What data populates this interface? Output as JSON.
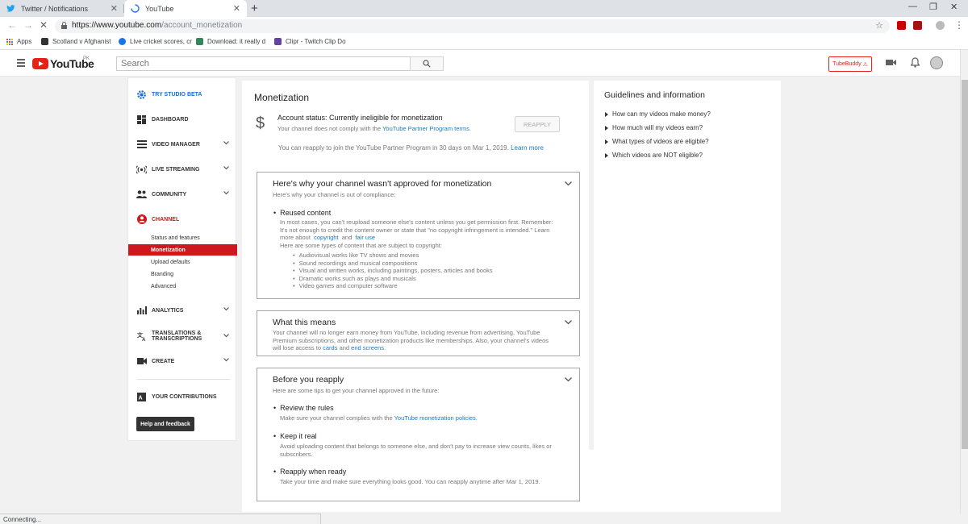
{
  "browser": {
    "tabs": [
      {
        "title": "Twitter / Notifications"
      },
      {
        "title": "YouTube"
      }
    ],
    "url_host": "https://www.youtube.com",
    "url_path": "/account_monetization",
    "bookmarks": [
      {
        "label": "Apps"
      },
      {
        "label": "Scotland v Afghanist"
      },
      {
        "label": "Live cricket scores, cr"
      },
      {
        "label": "Download: it really d"
      },
      {
        "label": "Clipr - Twitch Clip Do"
      }
    ],
    "status_text": "Connecting..."
  },
  "masthead": {
    "logo_text": "YouTube",
    "country": "PK",
    "search_placeholder": "Search",
    "tubebuddy_label": "TubeBuddy"
  },
  "leftnav": {
    "studio_beta": "TRY STUDIO BETA",
    "items": [
      {
        "label": "DASHBOARD"
      },
      {
        "label": "VIDEO MANAGER"
      },
      {
        "label": "LIVE STREAMING"
      },
      {
        "label": "COMMUNITY"
      },
      {
        "label": "CHANNEL"
      },
      {
        "label": "ANALYTICS"
      },
      {
        "label": "TRANSLATIONS & TRANSCRIPTIONS"
      },
      {
        "label": "CREATE"
      },
      {
        "label": "YOUR CONTRIBUTIONS"
      }
    ],
    "channel_subitems": [
      {
        "label": "Status and features"
      },
      {
        "label": "Monetization"
      },
      {
        "label": "Upload defaults"
      },
      {
        "label": "Branding"
      },
      {
        "label": "Advanced"
      }
    ],
    "help_button": "Help and feedback"
  },
  "main": {
    "title": "Monetization",
    "account_status": "Account status: Currently ineligible for monetization",
    "account_sub_prefix": "Your channel does not comply with the ",
    "account_sub_link": "YouTube Partner Program terms",
    "account_sub_suffix": ".",
    "reapply_button": "REAPPLY",
    "reapply_note": "You can reapply to join the YouTube Partner Program in 30 days on Mar 1, 2019.",
    "learn_more": "Learn more",
    "why": {
      "heading": "Here's why your channel wasn't approved for monetization",
      "sub": "Here's why your channel is out of compliance:",
      "bullet": "Reused content",
      "para_line1": "In most cases, you can't reupload someone else's content unless you get permission first. Remember:",
      "para_line2": "It's not enough to credit the content owner or state that \"no copyright infringement is intended.\" Learn",
      "para_line3_prefix": "more about",
      "copyright_link": "copyright",
      "and_word": "and",
      "fair_use_link": "fair use",
      "types_intro": "Here are some types of content that are subject to copyright:",
      "types": [
        "Audiovisual works like TV shows and movies",
        "Sound recordings and musical compositions",
        "Visual and written works, including paintings, posters, articles and books",
        "Dramatic works such as plays and musicals",
        "Video games and computer software"
      ]
    },
    "means": {
      "heading": "What this means",
      "line1": "Your channel will no longer earn money from YouTube, including revenue from advertising, YouTube",
      "line2": "Premium subscriptions, and other monetization products like memberships. Also, your channel's videos",
      "line3_prefix": "will lose access to",
      "cards_link": "cards",
      "and_word": "and",
      "end_screens_link": "end screens",
      "period": "."
    },
    "before": {
      "heading": "Before you reapply",
      "sub": "Here are some tips to get your channel approved in the future:",
      "tips": [
        {
          "title": "Review the rules",
          "text_prefix": "Make sure your channel complies with the ",
          "link": "YouTube monetization policies",
          "text_suffix": "."
        },
        {
          "title": "Keep it real",
          "line1": "Avoid uploading content that belongs to someone else, and don't pay to increase view counts, likes or",
          "line2": "subscribers."
        },
        {
          "title": "Reapply when ready",
          "text": "Take your time and make sure everything looks good. You can reapply anytime after Mar 1, 2019."
        }
      ]
    }
  },
  "guidelines": {
    "title": "Guidelines and information",
    "links": [
      {
        "label": "How can my videos make money?"
      },
      {
        "label": "How much will my videos earn?"
      },
      {
        "label": "What types of videos are eligible?"
      },
      {
        "label": "Which videos are NOT eligible?"
      }
    ]
  },
  "colors": {
    "youtube_red": "#e62117",
    "link_blue": "#167ac6",
    "active_nav": "#cc181e"
  }
}
